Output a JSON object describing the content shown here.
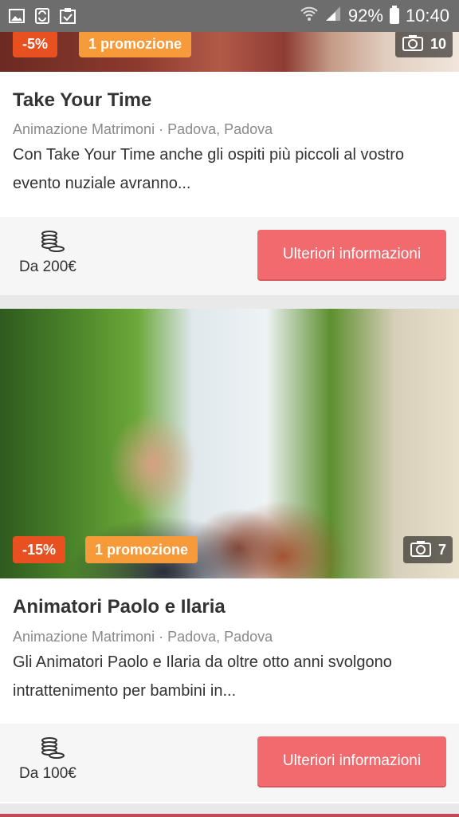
{
  "status_bar": {
    "battery": "92%",
    "time": "10:40"
  },
  "cards": [
    {
      "discount": "-5%",
      "promo": "1 promozione",
      "photos": "10",
      "title": "Take Your Time",
      "category": "Animazione Matrimoni · Padova, Padova",
      "description": "Con Take Your Time anche gli ospiti più piccoli al vostro evento nuziale avranno...",
      "price": "Da 200€",
      "button": "Ulteriori informazioni"
    },
    {
      "discount": "-15%",
      "promo": "1 promozione",
      "photos": "7",
      "title": "Animatori Paolo e Ilaria",
      "category": "Animazione Matrimoni · Padova, Padova",
      "description": "Gli Animatori Paolo e Ilaria da oltre otto anni svolgono intrattenimento per bambini in...",
      "price": "Da 100€",
      "button": "Ulteriori informazioni"
    }
  ]
}
